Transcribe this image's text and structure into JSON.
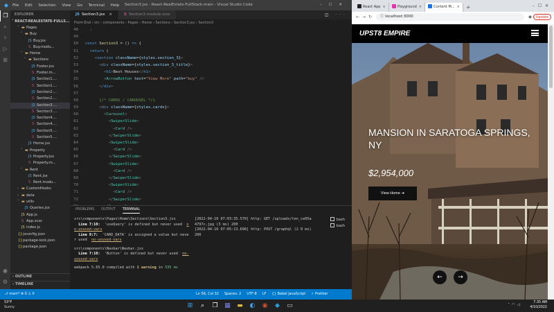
{
  "vscode": {
    "menu": [
      "File",
      "Edit",
      "Selection",
      "View",
      "Go",
      "Terminal",
      "Help"
    ],
    "window_title": "Section3.jsx - React-RealEstate-FullStack-main - Visual Studio Code",
    "explorer_header": "EXPLORER",
    "project_name": "REACT-REALESTATE-FULLS...",
    "tree": [
      {
        "label": "Pages",
        "depth": 2,
        "type": "folder",
        "open": true
      },
      {
        "label": "Buy",
        "depth": 3,
        "type": "folder",
        "open": true
      },
      {
        "label": "Buy.jsx",
        "depth": 4,
        "type": "jsx"
      },
      {
        "label": "Buy.modu...",
        "depth": 4,
        "type": "scss"
      },
      {
        "label": "Home",
        "depth": 3,
        "type": "folder",
        "open": true
      },
      {
        "label": "Sections",
        "depth": 4,
        "type": "folder",
        "open": true
      },
      {
        "label": "Footer.jsx",
        "depth": 5,
        "type": "jsx"
      },
      {
        "label": "Footer.m...",
        "depth": 5,
        "type": "scss"
      },
      {
        "label": "Section1....",
        "depth": 5,
        "type": "jsx"
      },
      {
        "label": "Section1....",
        "depth": 5,
        "type": "scss"
      },
      {
        "label": "Section2....",
        "depth": 5,
        "type": "jsx"
      },
      {
        "label": "Section2....",
        "depth": 5,
        "type": "scss"
      },
      {
        "label": "Section3....",
        "depth": 5,
        "type": "jsx",
        "selected": true
      },
      {
        "label": "Section3....",
        "depth": 5,
        "type": "scss"
      },
      {
        "label": "Section4....",
        "depth": 5,
        "type": "jsx"
      },
      {
        "label": "Section4....",
        "depth": 5,
        "type": "scss"
      },
      {
        "label": "Section5....",
        "depth": 5,
        "type": "jsx"
      },
      {
        "label": "Section5....",
        "depth": 5,
        "type": "scss"
      },
      {
        "label": "Home.jsx",
        "depth": 4,
        "type": "jsx"
      },
      {
        "label": "Property",
        "depth": 3,
        "type": "folder",
        "open": true
      },
      {
        "label": "Property.jsx",
        "depth": 4,
        "type": "jsx"
      },
      {
        "label": "Property.m...",
        "depth": 4,
        "type": "scss"
      },
      {
        "label": "Rent",
        "depth": 3,
        "type": "folder",
        "open": true
      },
      {
        "label": "Rent.jsx",
        "depth": 4,
        "type": "jsx"
      },
      {
        "label": "Rent.modu...",
        "depth": 4,
        "type": "scss"
      },
      {
        "label": "CustomHooks",
        "depth": 2,
        "type": "folder",
        "open": false
      },
      {
        "label": "data",
        "depth": 2,
        "type": "folder",
        "open": false
      },
      {
        "label": "utils",
        "depth": 2,
        "type": "folder",
        "open": true
      },
      {
        "label": "Queries.jsx",
        "depth": 3,
        "type": "jsx"
      },
      {
        "label": "App.js",
        "depth": 2,
        "type": "js"
      },
      {
        "label": "App.scss",
        "depth": 2,
        "type": "scss"
      },
      {
        "label": "index.js",
        "depth": 2,
        "type": "js"
      },
      {
        "label": "jsconfig.json",
        "depth": 1,
        "type": "json"
      },
      {
        "label": "package-lock.json",
        "depth": 1,
        "type": "json"
      },
      {
        "label": "package.json",
        "depth": 1,
        "type": "json"
      }
    ],
    "outline_label": "OUTLINE",
    "timeline_label": "TIMELINE",
    "tabs": [
      {
        "label": "Section3.jsx",
        "active": true
      },
      {
        "label": "Section3.module.scss",
        "active": false
      }
    ],
    "tab_actions": "◫ ···",
    "breadcrumb": "Front-End › src › components › Pages › Home › Sections › Section3.jsx › Section3",
    "code_lines": [
      {
        "n": "48",
        "html": "<span class='pu'>  ;</span>"
      },
      {
        "n": "49",
        "html": ""
      },
      {
        "n": "50",
        "html": "<span class='kw'>const</span> <span class='fn'>Section3</span> = () <span class='kw'>=&gt;</span> {"
      },
      {
        "n": "51",
        "html": "  <span class='kw'>return</span> ("
      },
      {
        "n": "52",
        "html": "    <span class='pu'>&lt;</span><span class='hl'>section</span> <span class='at'>className</span>={<span class='at'>styles</span>.<span class='at'>section_3</span>}<span class='pu'>&gt;</span>"
      },
      {
        "n": "53",
        "html": "      <span class='pu'>&lt;</span><span class='hl'>div</span> <span class='at'>className</span>={<span class='at'>styles</span>.<span class='at'>section_3_title</span>}<span class='pu'>&gt;</span>"
      },
      {
        "n": "54",
        "html": "        <span class='pu'>&lt;</span><span class='hl'>h1</span><span class='pu'>&gt;</span>Best Houses<span class='pu'>&lt;/</span><span class='hl'>h1</span><span class='pu'>&gt;</span>"
      },
      {
        "n": "55",
        "html": "        <span class='pu'>&lt;</span><span class='tg'>ArrowButton</span> <span class='at'>text</span>=<span class='st'>\"View More\"</span> <span class='at'>path</span>=<span class='st'>\"buy\"</span> <span class='pu'>/&gt;</span>"
      },
      {
        "n": "56",
        "html": "      <span class='pu'>&lt;/</span><span class='hl'>div</span><span class='pu'>&gt;</span>"
      },
      {
        "n": "57",
        "html": ""
      },
      {
        "n": "58",
        "html": "      <span class='cm'>{/* CARDS / CAROUSEL */}</span>"
      },
      {
        "n": "59",
        "html": "      <span class='pu'>&lt;</span><span class='hl'>div</span> <span class='at'>className</span>={<span class='at'>styles</span>.<span class='at'>cards</span>}<span class='pu'>&gt;</span>"
      },
      {
        "n": "60",
        "html": "        <span class='pu'>&lt;</span><span class='tg'>Carousel</span><span class='pu'>&gt;</span>"
      },
      {
        "n": "61",
        "html": "          <span class='pu'>&lt;</span><span class='tg'>SwiperSlide</span><span class='pu'>&gt;</span>"
      },
      {
        "n": "62",
        "html": "            <span class='pu'>&lt;</span><span class='tg'>Card</span> <span class='pu'>/&gt;</span>"
      },
      {
        "n": "63",
        "html": "          <span class='pu'>&lt;/</span><span class='tg'>SwiperSlide</span><span class='pu'>&gt;</span>"
      },
      {
        "n": "64",
        "html": "          <span class='pu'>&lt;</span><span class='tg'>SwiperSlide</span><span class='pu'>&gt;</span>"
      },
      {
        "n": "65",
        "html": "            <span class='pu'>&lt;</span><span class='tg'>Card</span> <span class='pu'>/&gt;</span>"
      },
      {
        "n": "66",
        "html": "          <span class='pu'>&lt;/</span><span class='tg'>SwiperSlide</span><span class='pu'>&gt;</span>"
      },
      {
        "n": "67",
        "html": "          <span class='pu'>&lt;</span><span class='tg'>SwiperSlide</span><span class='pu'>&gt;</span>"
      },
      {
        "n": "68",
        "html": "            <span class='pu'>&lt;</span><span class='tg'>Card</span> <span class='pu'>/&gt;</span>"
      },
      {
        "n": "69",
        "html": "          <span class='pu'>&lt;/</span><span class='tg'>SwiperSlide</span><span class='pu'>&gt;</span>"
      },
      {
        "n": "70",
        "html": "          <span class='pu'>&lt;</span><span class='tg'>SwiperSlide</span><span class='pu'>&gt;</span>"
      },
      {
        "n": "71",
        "html": "            <span class='pu'>&lt;</span><span class='tg'>Card</span> <span class='pu'>/&gt;</span>"
      },
      {
        "n": "72",
        "html": "          <span class='pu'>&lt;/</span><span class='tg'>SwiperSlide</span><span class='pu'>&gt;</span>"
      },
      {
        "n": "73",
        "html": "        <span class='pu'>&lt;/</span><span class='tg'>Carousel</span><span class='pu'>&gt;</span>"
      },
      {
        "n": "74",
        "html": "      <span class='pu'>&lt;/</span><span class='hl'>div</span><span class='pu'>&gt;</span>"
      }
    ],
    "panel_tabs": [
      {
        "label": "PROBLEMS",
        "active": false
      },
      {
        "label": "OUTPUT",
        "active": false
      },
      {
        "label": "TERMINAL",
        "active": true
      }
    ],
    "terminal_left": [
      "src\\components\\Pages\\Home\\Sections\\Section3.jsx",
      "  Line 7:10:  'useQuery' is defined but never used  no-unused-vars",
      "  Line 9:7:  'CARD_DATA' is assigned a value but never used  no-unused-vars",
      "",
      "src\\components\\Navbar\\Navbar.jsx",
      "  Line 7:10:  'Button' is defined but never used  no-unused-vars",
      "",
      "webpack 5.65.0 compiled with 1 warning in 535 ms"
    ],
    "terminal_right": [
      "[2022-04-10 07:03:35.570] http: GET /uploads/ten_ce05a4797c.jpg (3 ms) 200",
      "[2022-04-10 07:05:13.698] http: POST /graphql (2 0 ms) 200"
    ],
    "terminal_list": [
      {
        "label": "bash"
      },
      {
        "label": "bash"
      }
    ],
    "status_left": "⎇ main*  ⊗ 0 ⚠ 0",
    "status_right": [
      "Ln 56, Col 32",
      "Spaces: 2",
      "UTF-8",
      "LF",
      "{} Babel JavaScript",
      "✓ Prettier"
    ]
  },
  "browser": {
    "tabs": [
      {
        "label": "React App",
        "active": false
      },
      {
        "label": "Playground",
        "active": false
      },
      {
        "label": "Content M...",
        "active": true
      }
    ],
    "new_tab": "+",
    "url": "localhost:3000",
    "update_label": "Update",
    "site": {
      "brand": "UPST8 EMPIRE",
      "hero_title": "MANSION IN SARATOGA SPRINGS, NY",
      "hero_price": "$2,954,000",
      "cta_label": "View Home",
      "cta_arrow": "➜",
      "prev_arrow": "←",
      "next_arrow": "→"
    }
  },
  "taskbar": {
    "weather_temp": "53°F",
    "weather_desc": "Sunny",
    "time": "7:35 AM",
    "date": "4/10/2022"
  },
  "colors": {
    "vscode_accent": "#007acc",
    "terminal_warn": "#d7ba7d",
    "site_navbar": "#000000"
  }
}
